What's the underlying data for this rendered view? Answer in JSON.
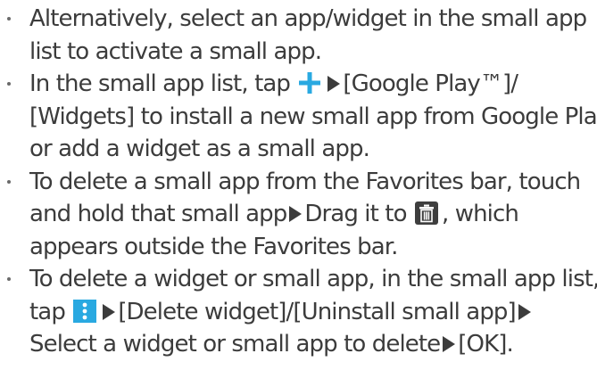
{
  "colors": {
    "text": "#3c3c3c",
    "add_icon": "#29a9e1",
    "menu_icon": "#29a9e1",
    "trash_icon": "#3e3e3e"
  },
  "icons": {
    "add": "plus-icon",
    "trash": "trash-icon",
    "menu": "vertical-dots-icon",
    "arrow": "play-triangle-icon"
  },
  "items": [
    {
      "line1": "Alternatively, select an app/widget in the small app",
      "line2": "list to activate a small app."
    },
    {
      "l1_pre": "In the small app list, tap",
      "l1_post": "[Google Play™]/",
      "line2": "[Widgets] to install a new small app from Google Play",
      "line3": "or add a widget as a small app."
    },
    {
      "line1": "To delete a small app from the Favorites bar, touch",
      "l2_pre": "and hold that small app",
      "l2_mid": "Drag it to",
      "l2_post": ", which",
      "line3": "appears outside the Favorites bar."
    },
    {
      "line1": "To delete a widget or small app, in the small app list,",
      "l2_pre": "tap",
      "l2_mid": "[Delete widget]/[Uninstall small app]",
      "l3_pre": "Select a widget or small app to delete",
      "l3_post": "[OK]."
    }
  ]
}
